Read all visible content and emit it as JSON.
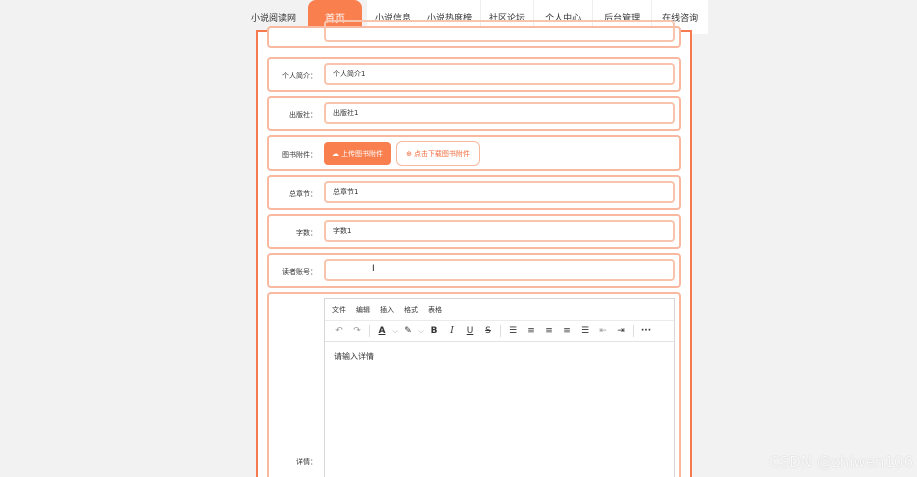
{
  "nav": {
    "site_title": "小说阅读网",
    "items": [
      {
        "label": "首页",
        "active": true
      },
      {
        "label": "小说信息"
      },
      {
        "label": "小说热度榜"
      },
      {
        "label": "社区论坛"
      },
      {
        "label": "个人中心"
      },
      {
        "label": "后台管理"
      },
      {
        "label": "在线咨询"
      }
    ]
  },
  "form": {
    "intro": {
      "label": "个人简介：",
      "value": "个人简介1"
    },
    "publisher": {
      "label": "出版社：",
      "value": "出版社1"
    },
    "attachment": {
      "label": "图书附件：",
      "upload_label": "上传图书附件",
      "download_label": "点击下载图书附件"
    },
    "chapters": {
      "label": "总章节：",
      "value": "总章节1"
    },
    "word_count": {
      "label": "字数：",
      "value": "字数1"
    },
    "reader_account": {
      "label": "读者账号：",
      "value": ""
    },
    "details": {
      "label": "详情：",
      "menu": [
        "文件",
        "编辑",
        "插入",
        "格式",
        "表格"
      ],
      "placeholder": "请输入详情"
    }
  },
  "toolbar_icons": [
    "undo-icon",
    "redo-icon",
    "text-color-icon",
    "highlight-icon",
    "bold-icon",
    "italic-icon",
    "underline-icon",
    "strikethrough-icon",
    "line-height-icon",
    "align-left-icon",
    "align-center-icon",
    "align-right-icon",
    "align-justify-icon",
    "outdent-icon",
    "indent-icon",
    "more-icon"
  ],
  "watermark": "CSDN @zhiwen106",
  "colors": {
    "accent": "#f97f4f",
    "tab_underline": "#f6c012",
    "row_border": "#f9b9a0"
  }
}
